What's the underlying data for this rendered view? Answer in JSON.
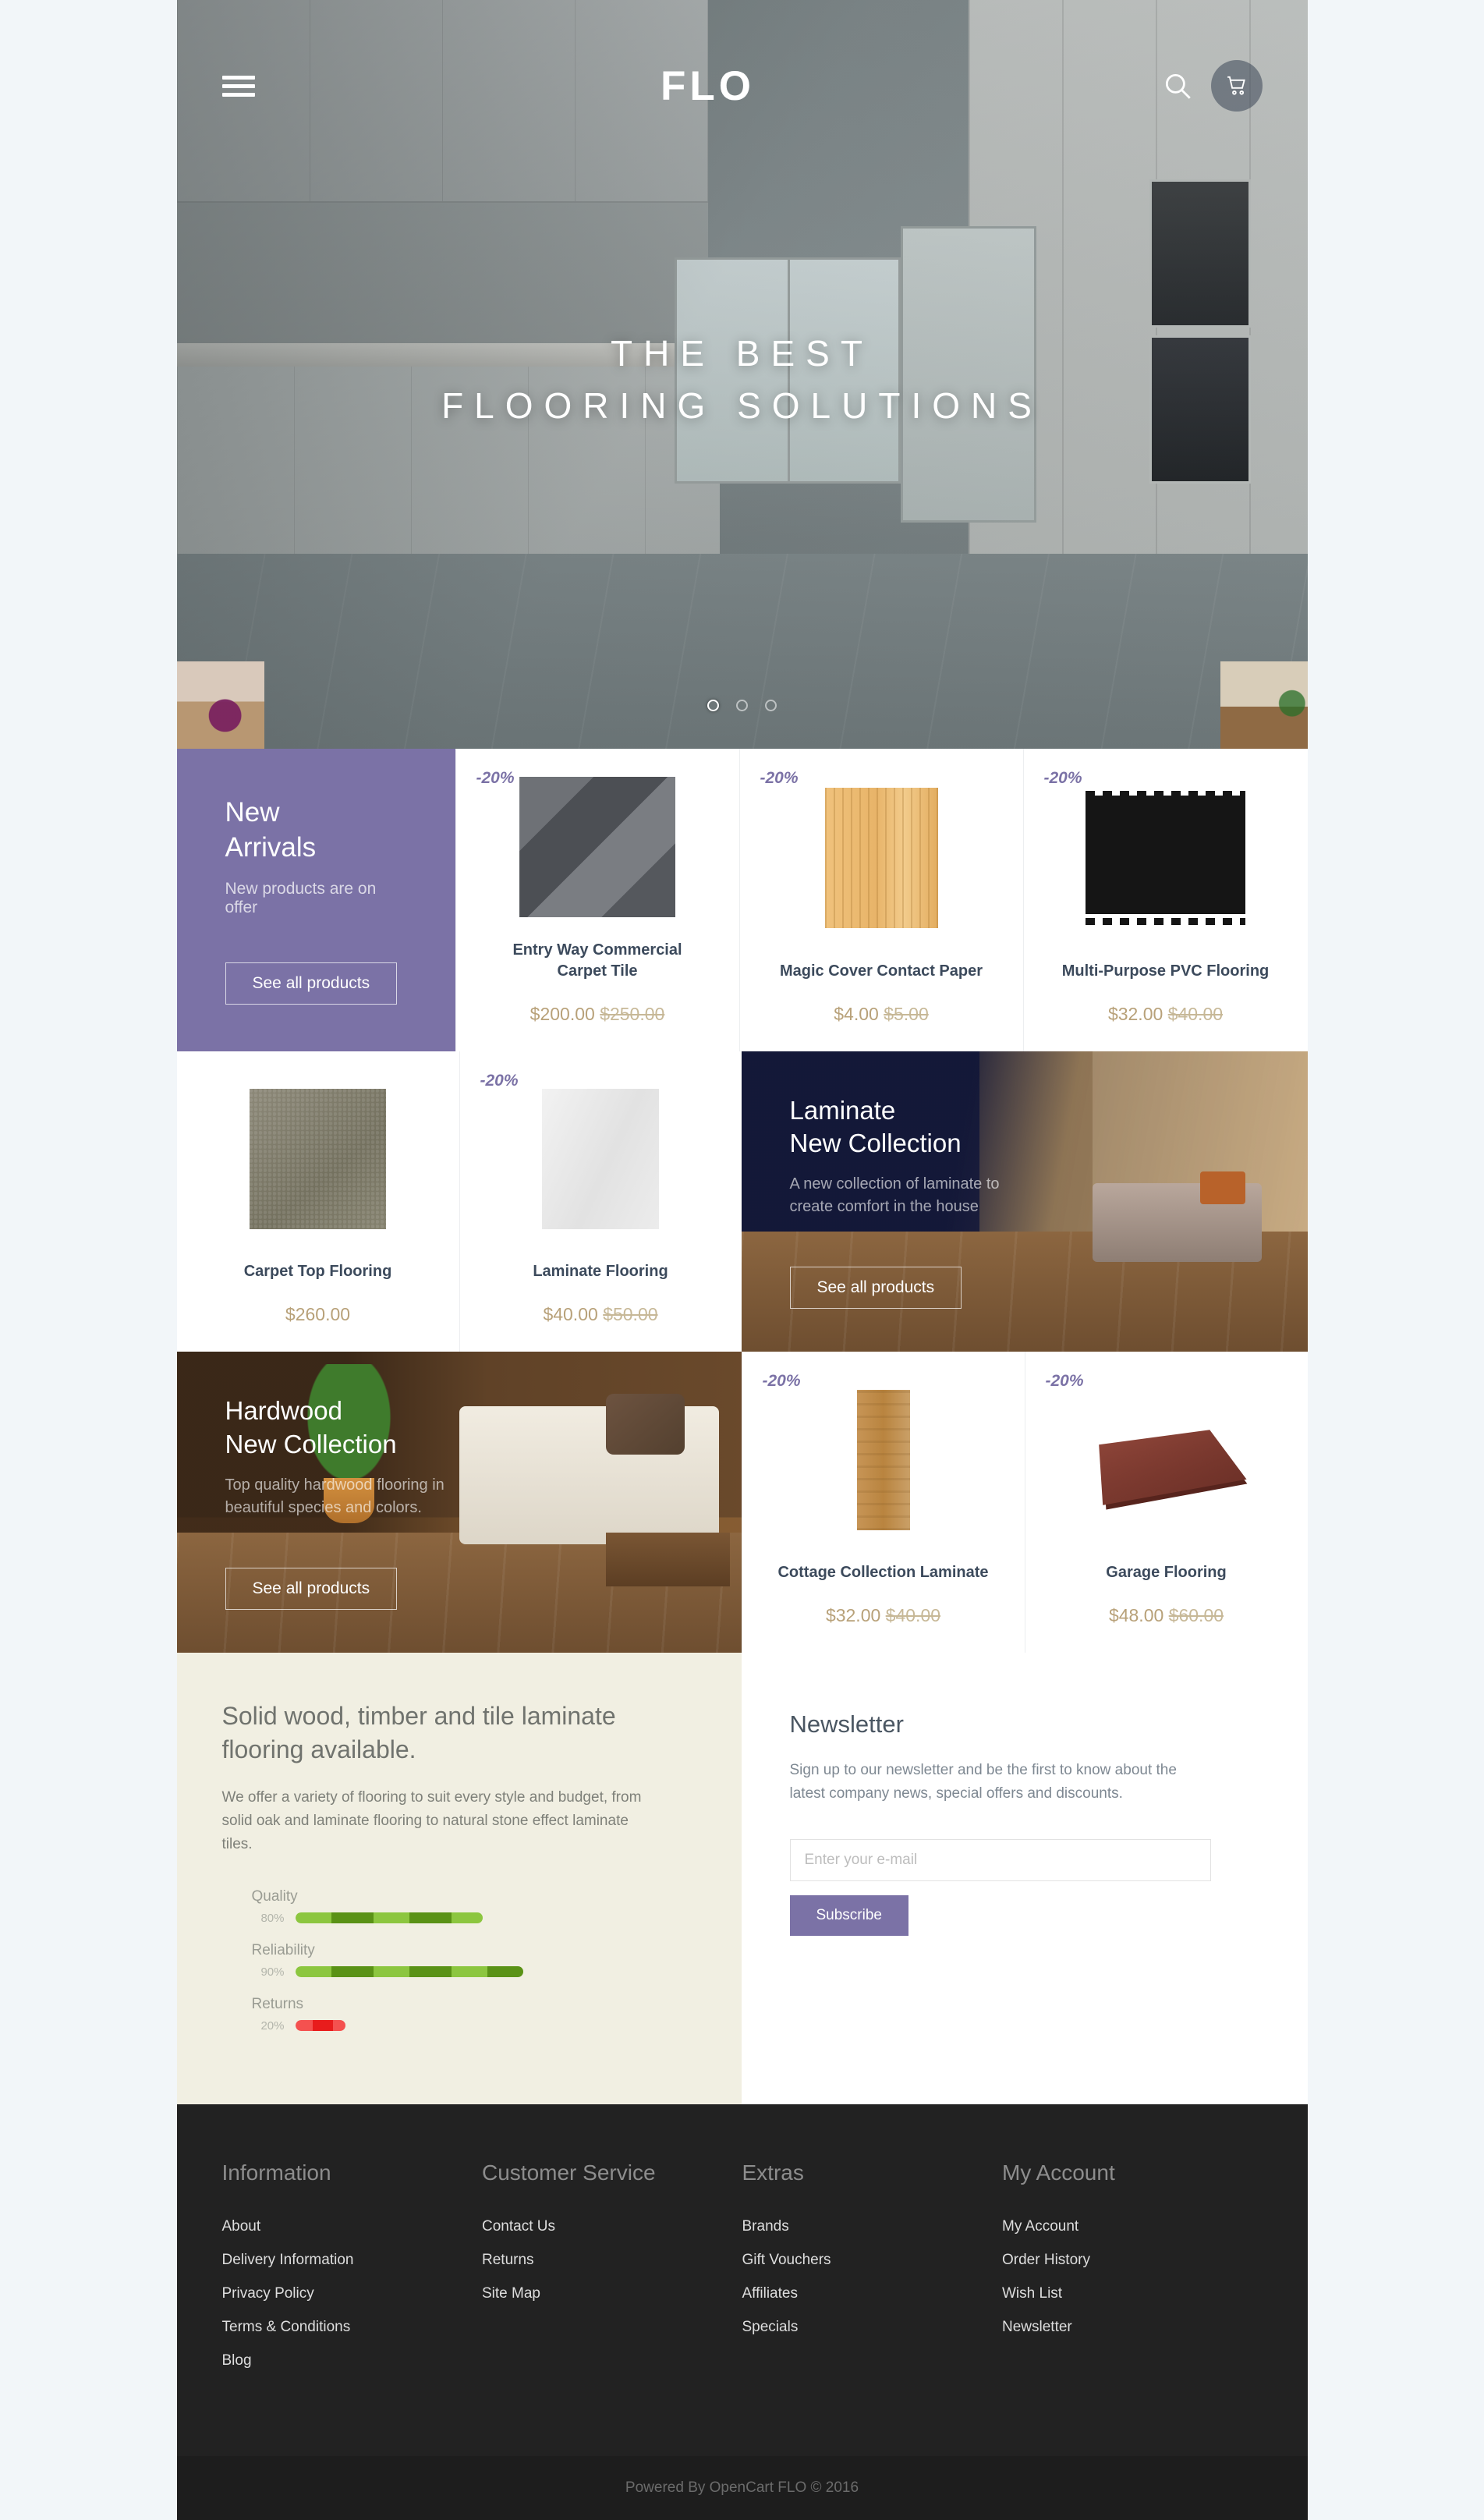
{
  "header": {
    "logo": "FLO",
    "menu_icon": "hamburger-icon",
    "search_icon": "search-icon",
    "cart_icon": "cart-icon"
  },
  "hero": {
    "line1": "THE BEST",
    "line2": "FLOORING SOLUTIONS",
    "slides": 3,
    "active_slide": 1
  },
  "promo_new_arrivals": {
    "title_line1": "New",
    "title_line2": "Arrivals",
    "subtitle": "New products are on offer",
    "button": "See all products"
  },
  "banner_laminate": {
    "title_line1": "Laminate",
    "title_line2": "New Collection",
    "subtitle": "A new collection of laminate to create comfort in the house",
    "button": "See all products"
  },
  "banner_hardwood": {
    "title_line1": "Hardwood",
    "title_line2": "New Collection",
    "subtitle": "Top quality hardwood flooring in beautiful species and colors.",
    "button": "See all products"
  },
  "products": [
    {
      "badge": "-20%",
      "title": "Entry Way Commercial Carpet Tile",
      "price": "$200.00",
      "old_price": "$250.00"
    },
    {
      "badge": "-20%",
      "title": "Magic Cover Contact Paper",
      "price": "$4.00",
      "old_price": "$5.00"
    },
    {
      "badge": "-20%",
      "title": "Multi-Purpose PVC Flooring",
      "price": "$32.00",
      "old_price": "$40.00"
    },
    {
      "badge": "",
      "title": "Carpet Top Flooring",
      "price": "$260.00",
      "old_price": ""
    },
    {
      "badge": "-20%",
      "title": "Laminate Flooring",
      "price": "$40.00",
      "old_price": "$50.00"
    },
    {
      "badge": "-20%",
      "title": "Cottage Collection Laminate",
      "price": "$32.00",
      "old_price": "$40.00"
    },
    {
      "badge": "-20%",
      "title": "Garage Flooring",
      "price": "$48.00",
      "old_price": "$60.00"
    }
  ],
  "info": {
    "heading": "Solid wood, timber and tile laminate flooring available.",
    "body": "We offer a variety of flooring to suit every style and budget, from solid oak and laminate flooring to natural stone effect laminate tiles.",
    "bars": [
      {
        "label": "Quality",
        "percent_label": "80%",
        "value": 80,
        "color": "#8cc63f"
      },
      {
        "label": "Reliability",
        "percent_label": "90%",
        "value": 90,
        "color": "#8cc63f"
      },
      {
        "label": "Returns",
        "percent_label": "20%",
        "value": 20,
        "color": "#e81c1c"
      }
    ]
  },
  "newsletter": {
    "heading": "Newsletter",
    "body": "Sign up to our newsletter and be the first to know about the latest company news, special offers and discounts.",
    "placeholder": "Enter your e-mail",
    "value": "",
    "button": "Subscribe"
  },
  "footer": {
    "columns": [
      {
        "title": "Information",
        "links": [
          "About",
          "Delivery Information",
          "Privacy Policy",
          "Terms & Conditions",
          "Blog"
        ]
      },
      {
        "title": "Customer Service",
        "links": [
          "Contact Us",
          "Returns",
          "Site Map"
        ]
      },
      {
        "title": "Extras",
        "links": [
          "Brands",
          "Gift Vouchers",
          "Affiliates",
          "Specials"
        ]
      },
      {
        "title": "My Account",
        "links": [
          "My Account",
          "Order History",
          "Wish List",
          "Newsletter"
        ]
      }
    ],
    "copyright": "Powered By OpenCart FLO © 2016"
  },
  "colors": {
    "accent_purple": "#7b72a6",
    "page_bg": "#f2f6f9",
    "price_gold": "#b8a179",
    "footer_bg": "#222222",
    "info_bg": "#f1efe2"
  }
}
